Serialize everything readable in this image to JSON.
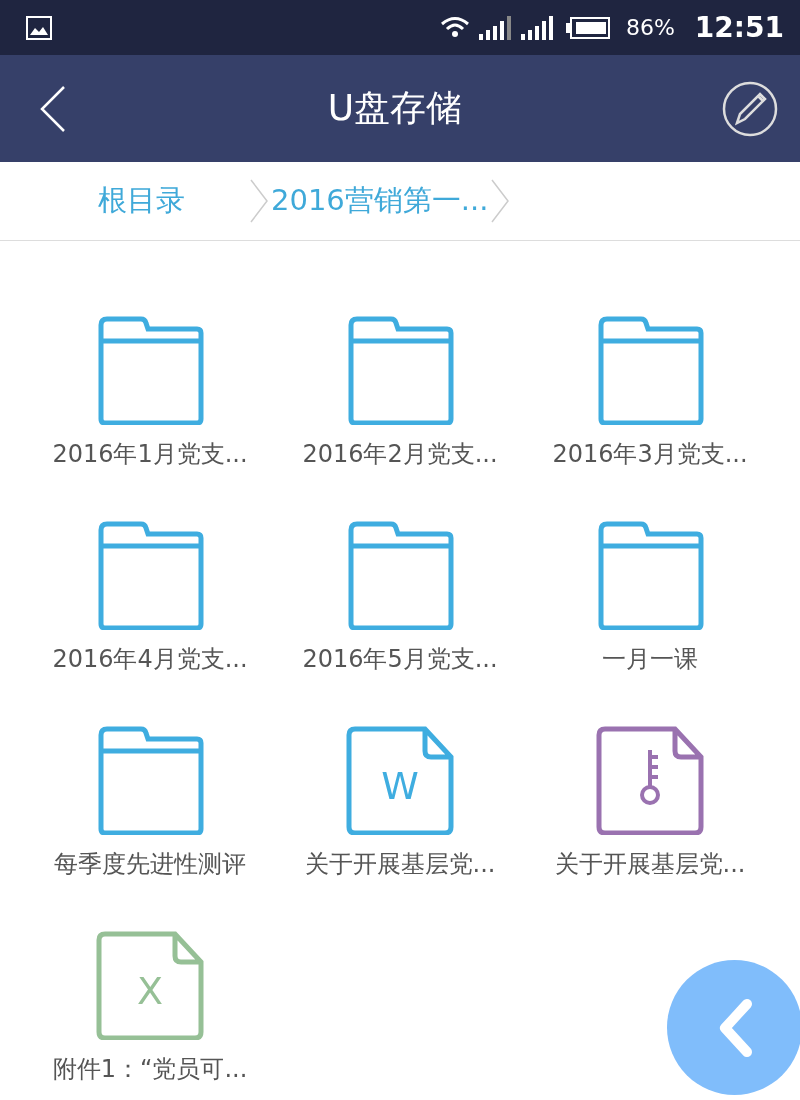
{
  "status_bar": {
    "battery": "86%",
    "time": "12:51"
  },
  "header": {
    "title": "U盘存储"
  },
  "breadcrumb": [
    {
      "label": "根目录"
    },
    {
      "label": "2016营销第一..."
    }
  ],
  "files": [
    {
      "kind": "folder",
      "name": "2016年1月党支..."
    },
    {
      "kind": "folder",
      "name": "2016年2月党支..."
    },
    {
      "kind": "folder",
      "name": "2016年3月党支..."
    },
    {
      "kind": "folder",
      "name": "2016年4月党支..."
    },
    {
      "kind": "folder",
      "name": "2016年5月党支..."
    },
    {
      "kind": "folder",
      "name": "一月一课"
    },
    {
      "kind": "folder",
      "name": "每季度先进性测评"
    },
    {
      "kind": "word",
      "badge": "W",
      "name": "关于开展基层党..."
    },
    {
      "kind": "zip",
      "name": "关于开展基层党..."
    },
    {
      "kind": "excel",
      "badge": "X",
      "name": "附件1：“党员可..."
    }
  ]
}
